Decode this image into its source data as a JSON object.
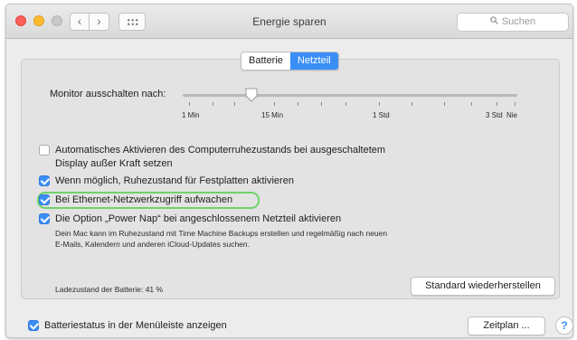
{
  "window": {
    "title": "Energie sparen",
    "nav_back_glyph": "‹",
    "nav_forward_glyph": "›",
    "search_placeholder": "Suchen",
    "search_icon": "magnifier-icon"
  },
  "tabs": {
    "items": [
      "Batterie",
      "Netzteil"
    ],
    "selected": "Netzteil"
  },
  "monitor_off": {
    "label": "Monitor ausschalten nach:",
    "ticks": [
      "1 Min",
      "15 Min",
      "1 Std",
      "3 Std",
      "Nie"
    ],
    "selected": "15 Min"
  },
  "options": [
    {
      "label_line1": "Automatisches Aktivieren des Computerruhezustands bei ausgeschaltetem",
      "label_line2": "Display außer Kraft setzen",
      "checked": false
    },
    {
      "label": "Wenn möglich, Ruhezustand für Festplatten aktivieren",
      "checked": true
    },
    {
      "label": "Bei Ethernet-Netzwerkzugriff aufwachen",
      "checked": true,
      "highlighted": true
    },
    {
      "label": "Die Option „Power Nap“ bei angeschlossenem Netzteil aktivieren",
      "checked": true,
      "description_line1": "Dein Mac kann im Ruhezustand mit Time Machine Backups erstellen und regelmäßig nach neuen",
      "description_line2": "E-Mails, Kalendern und anderen iCloud-Updates suchen."
    }
  ],
  "battery_level": "Ladezustand der Batterie: 41 %",
  "restore_button": "Standard wiederherstellen",
  "menubar_option": {
    "label": "Batteriestatus in der Menüleiste anzeigen",
    "checked": true
  },
  "schedule_button": "Zeitplan ...",
  "help_glyph": "?",
  "colors": {
    "accent": "#3b8ef6",
    "highlight_ring": "#6ed36a",
    "close": "#fc5f57",
    "minimize": "#fdbc2e"
  }
}
